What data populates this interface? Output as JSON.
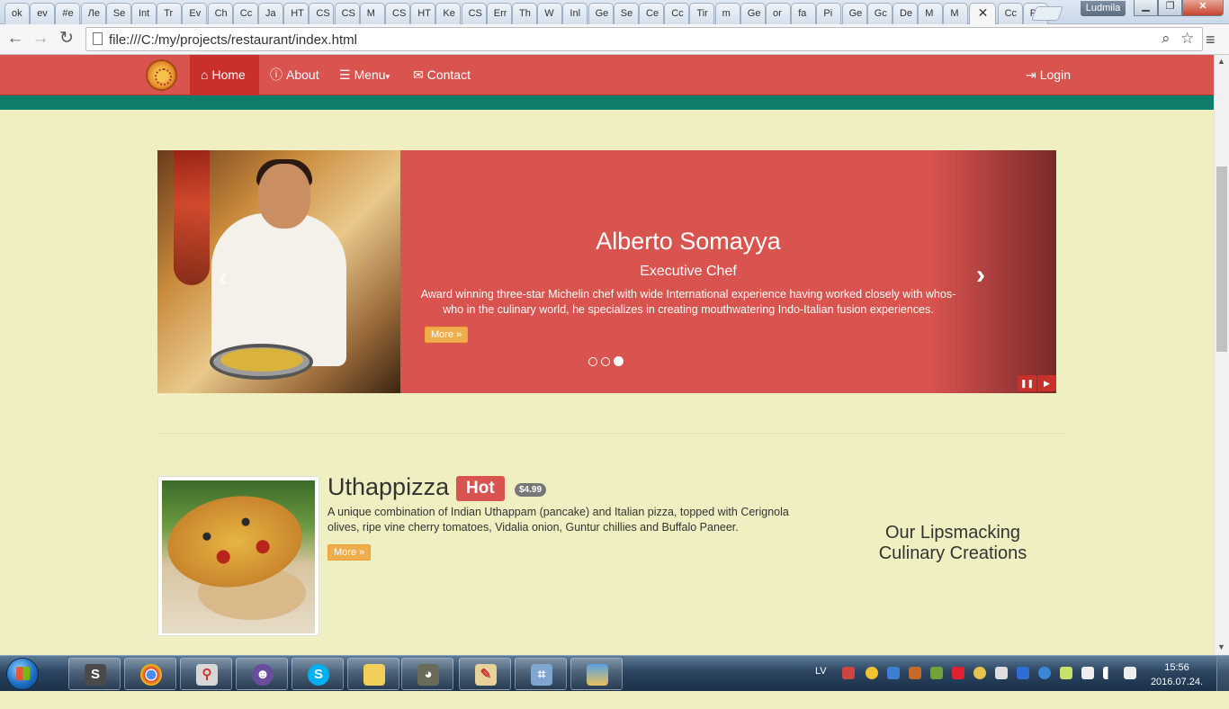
{
  "browser": {
    "tabs": [
      "ok",
      "ev",
      "#e",
      "Ле",
      "Se",
      "Int",
      "Tr",
      "Ev",
      "Ch",
      "Cc",
      "Ja",
      "HT",
      "CS",
      "CS",
      "M",
      "CS",
      "HT",
      "Ke",
      "CS",
      "Err",
      "Th",
      "W",
      "Inl",
      "Ge",
      "Se",
      "Ce",
      "Cc",
      "Tir",
      "m",
      "Ge",
      "or",
      "fa",
      "Pi",
      "Ge",
      "Gc",
      "De",
      "M",
      "M",
      "",
      "Cc",
      "Pi"
    ],
    "active_tab_index": 38,
    "user_name": "Ludmila",
    "url": "file:///C:/my/projects/restaurant/index.html"
  },
  "navbar": {
    "items": [
      {
        "label": "Home",
        "icon": "home-icon",
        "active": true
      },
      {
        "label": "About",
        "icon": "info-icon",
        "active": false
      },
      {
        "label": "Menu",
        "icon": "list-icon",
        "active": false,
        "caret": "▾"
      },
      {
        "label": "Contact",
        "icon": "envelope-icon",
        "active": false
      }
    ],
    "login_label": "Login"
  },
  "carousel": {
    "name": "Alberto Somayya",
    "role": "Executive Chef",
    "description": "Award winning three-star Michelin chef with wide International experience having worked closely with whos-who in the culinary world, he specializes in creating mouthwatering Indo-Italian fusion experiences.",
    "more_label": "More »",
    "slide_count": 3,
    "active_slide": 3
  },
  "dish": {
    "name": "Uthappizza",
    "label": "Hot",
    "price": "$4.99",
    "description": "A unique combination of Indian Uthappam (pancake) and Italian pizza, topped with Cerignola olives, ripe vine cherry tomatoes, Vidalia onion, Guntur chillies and Buffalo Paneer.",
    "more_label": "More »"
  },
  "tagline": "Our Lipsmacking Culinary Creations",
  "taskbar": {
    "language": "LV",
    "time": "15:56",
    "date": "2016.07.24."
  },
  "colors": {
    "navbar": "#d9534f",
    "teal": "#0e7e6b",
    "page_background": "#f0efc1",
    "more_button": "#f0ad4e"
  }
}
